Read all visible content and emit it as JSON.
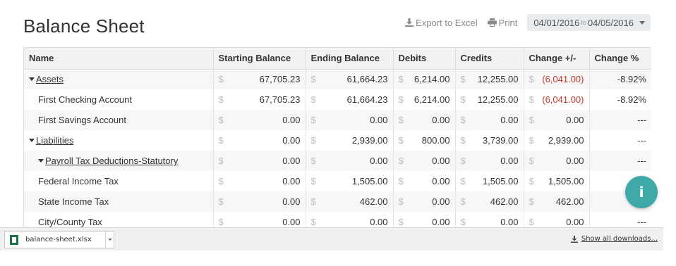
{
  "page": {
    "title": "Balance Sheet"
  },
  "toolbar": {
    "export_label": "Export to Excel",
    "print_label": "Print",
    "date_start": "04/01/2016",
    "date_sep": "to",
    "date_end": "04/05/2016"
  },
  "table": {
    "columns": [
      "Name",
      "Starting Balance",
      "Ending Balance",
      "Debits",
      "Credits",
      "Change +/-",
      "Change %"
    ],
    "currency_symbol": "$",
    "rows": [
      {
        "name": "Assets",
        "expandable": true,
        "start": "67,705.23",
        "end": "61,664.23",
        "debits": "6,214.00",
        "credits": "12,255.00",
        "change": "(6,041.00)",
        "change_negative": true,
        "pct": "-8.92%"
      },
      {
        "name": "First Checking Account",
        "expandable": false,
        "start": "67,705.23",
        "end": "61,664.23",
        "debits": "6,214.00",
        "credits": "12,255.00",
        "change": "(6,041.00)",
        "change_negative": true,
        "pct": "-8.92%"
      },
      {
        "name": "First Savings Account",
        "expandable": false,
        "start": "0.00",
        "end": "0.00",
        "debits": "0.00",
        "credits": "0.00",
        "change": "0.00",
        "change_negative": false,
        "pct": "---"
      },
      {
        "name": "Liabilities",
        "expandable": true,
        "start": "0.00",
        "end": "2,939.00",
        "debits": "800.00",
        "credits": "3,739.00",
        "change": "2,939.00",
        "change_negative": false,
        "pct": "---"
      },
      {
        "name": "Payroll Tax Deductions-Statutory",
        "expandable": true,
        "start": "0.00",
        "end": "0.00",
        "debits": "0.00",
        "credits": "0.00",
        "change": "0.00",
        "change_negative": false,
        "pct": "---"
      },
      {
        "name": "Federal Income Tax",
        "expandable": false,
        "start": "0.00",
        "end": "1,505.00",
        "debits": "0.00",
        "credits": "1,505.00",
        "change": "1,505.00",
        "change_negative": false,
        "pct": ""
      },
      {
        "name": "State Income Tax",
        "expandable": false,
        "start": "0.00",
        "end": "462.00",
        "debits": "0.00",
        "credits": "462.00",
        "change": "462.00",
        "change_negative": false,
        "pct": ""
      },
      {
        "name": "City/County Tax",
        "expandable": false,
        "start": "0.00",
        "end": "0.00",
        "debits": "0.00",
        "credits": "0.00",
        "change": "0.00",
        "change_negative": false,
        "pct": "---"
      }
    ]
  },
  "download_bar": {
    "file_name": "balance-sheet.xlsx",
    "show_all_label": "Show all downloads..."
  },
  "colors": {
    "accent": "#3fa9a8",
    "negative": "#c0392b",
    "header_bg": "#f2f2f2"
  },
  "icons": {
    "export": "download-icon",
    "print": "printer-icon",
    "info": "info-icon",
    "file": "excel-file-icon"
  }
}
